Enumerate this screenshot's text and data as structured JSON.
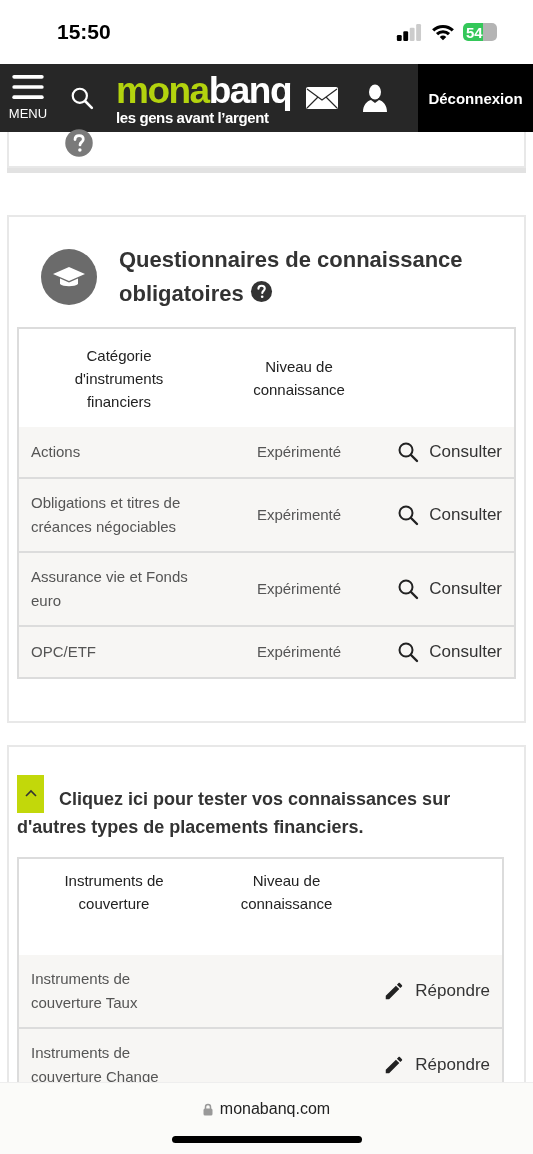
{
  "status_bar": {
    "time": "15:50",
    "battery": "54"
  },
  "header": {
    "menu_label": "MENU",
    "logo_part_1": "mona",
    "logo_part_2": "banq",
    "tagline": "les gens avant l’argent",
    "logout": "Déconnexion"
  },
  "mandatory_section": {
    "title": "Questionnaires de connaissance obligatoires",
    "table": {
      "columns": [
        "Catégorie d'instruments financiers",
        "Niveau de connaissance"
      ],
      "rows": [
        {
          "name": "Actions",
          "level": "Expérimenté",
          "action": "Consulter",
          "kind": "view"
        },
        {
          "name": "Obligations et titres de créances négociables",
          "level": "Expérimenté",
          "action": "Consulter",
          "kind": "view"
        },
        {
          "name": "Assurance vie et Fonds euro",
          "level": "Expérimenté",
          "action": "Consulter",
          "kind": "view"
        },
        {
          "name": "OPC/ETF",
          "level": "Expérimenté",
          "action": "Consulter",
          "kind": "view"
        }
      ]
    }
  },
  "other_section": {
    "expanded": true,
    "title": "Cliquez ici pour tester vos connaissances sur d'autres types de placements financiers.",
    "table": {
      "columns": [
        "Instruments de couverture",
        "Niveau de connaissance"
      ],
      "rows": [
        {
          "name": "Instruments de couverture Taux",
          "action": "Répondre",
          "kind": "answer"
        },
        {
          "name": "Instruments de couverture Change",
          "action": "Répondre",
          "kind": "answer"
        }
      ]
    }
  },
  "browser_bar": {
    "url": "monabanq.com"
  }
}
